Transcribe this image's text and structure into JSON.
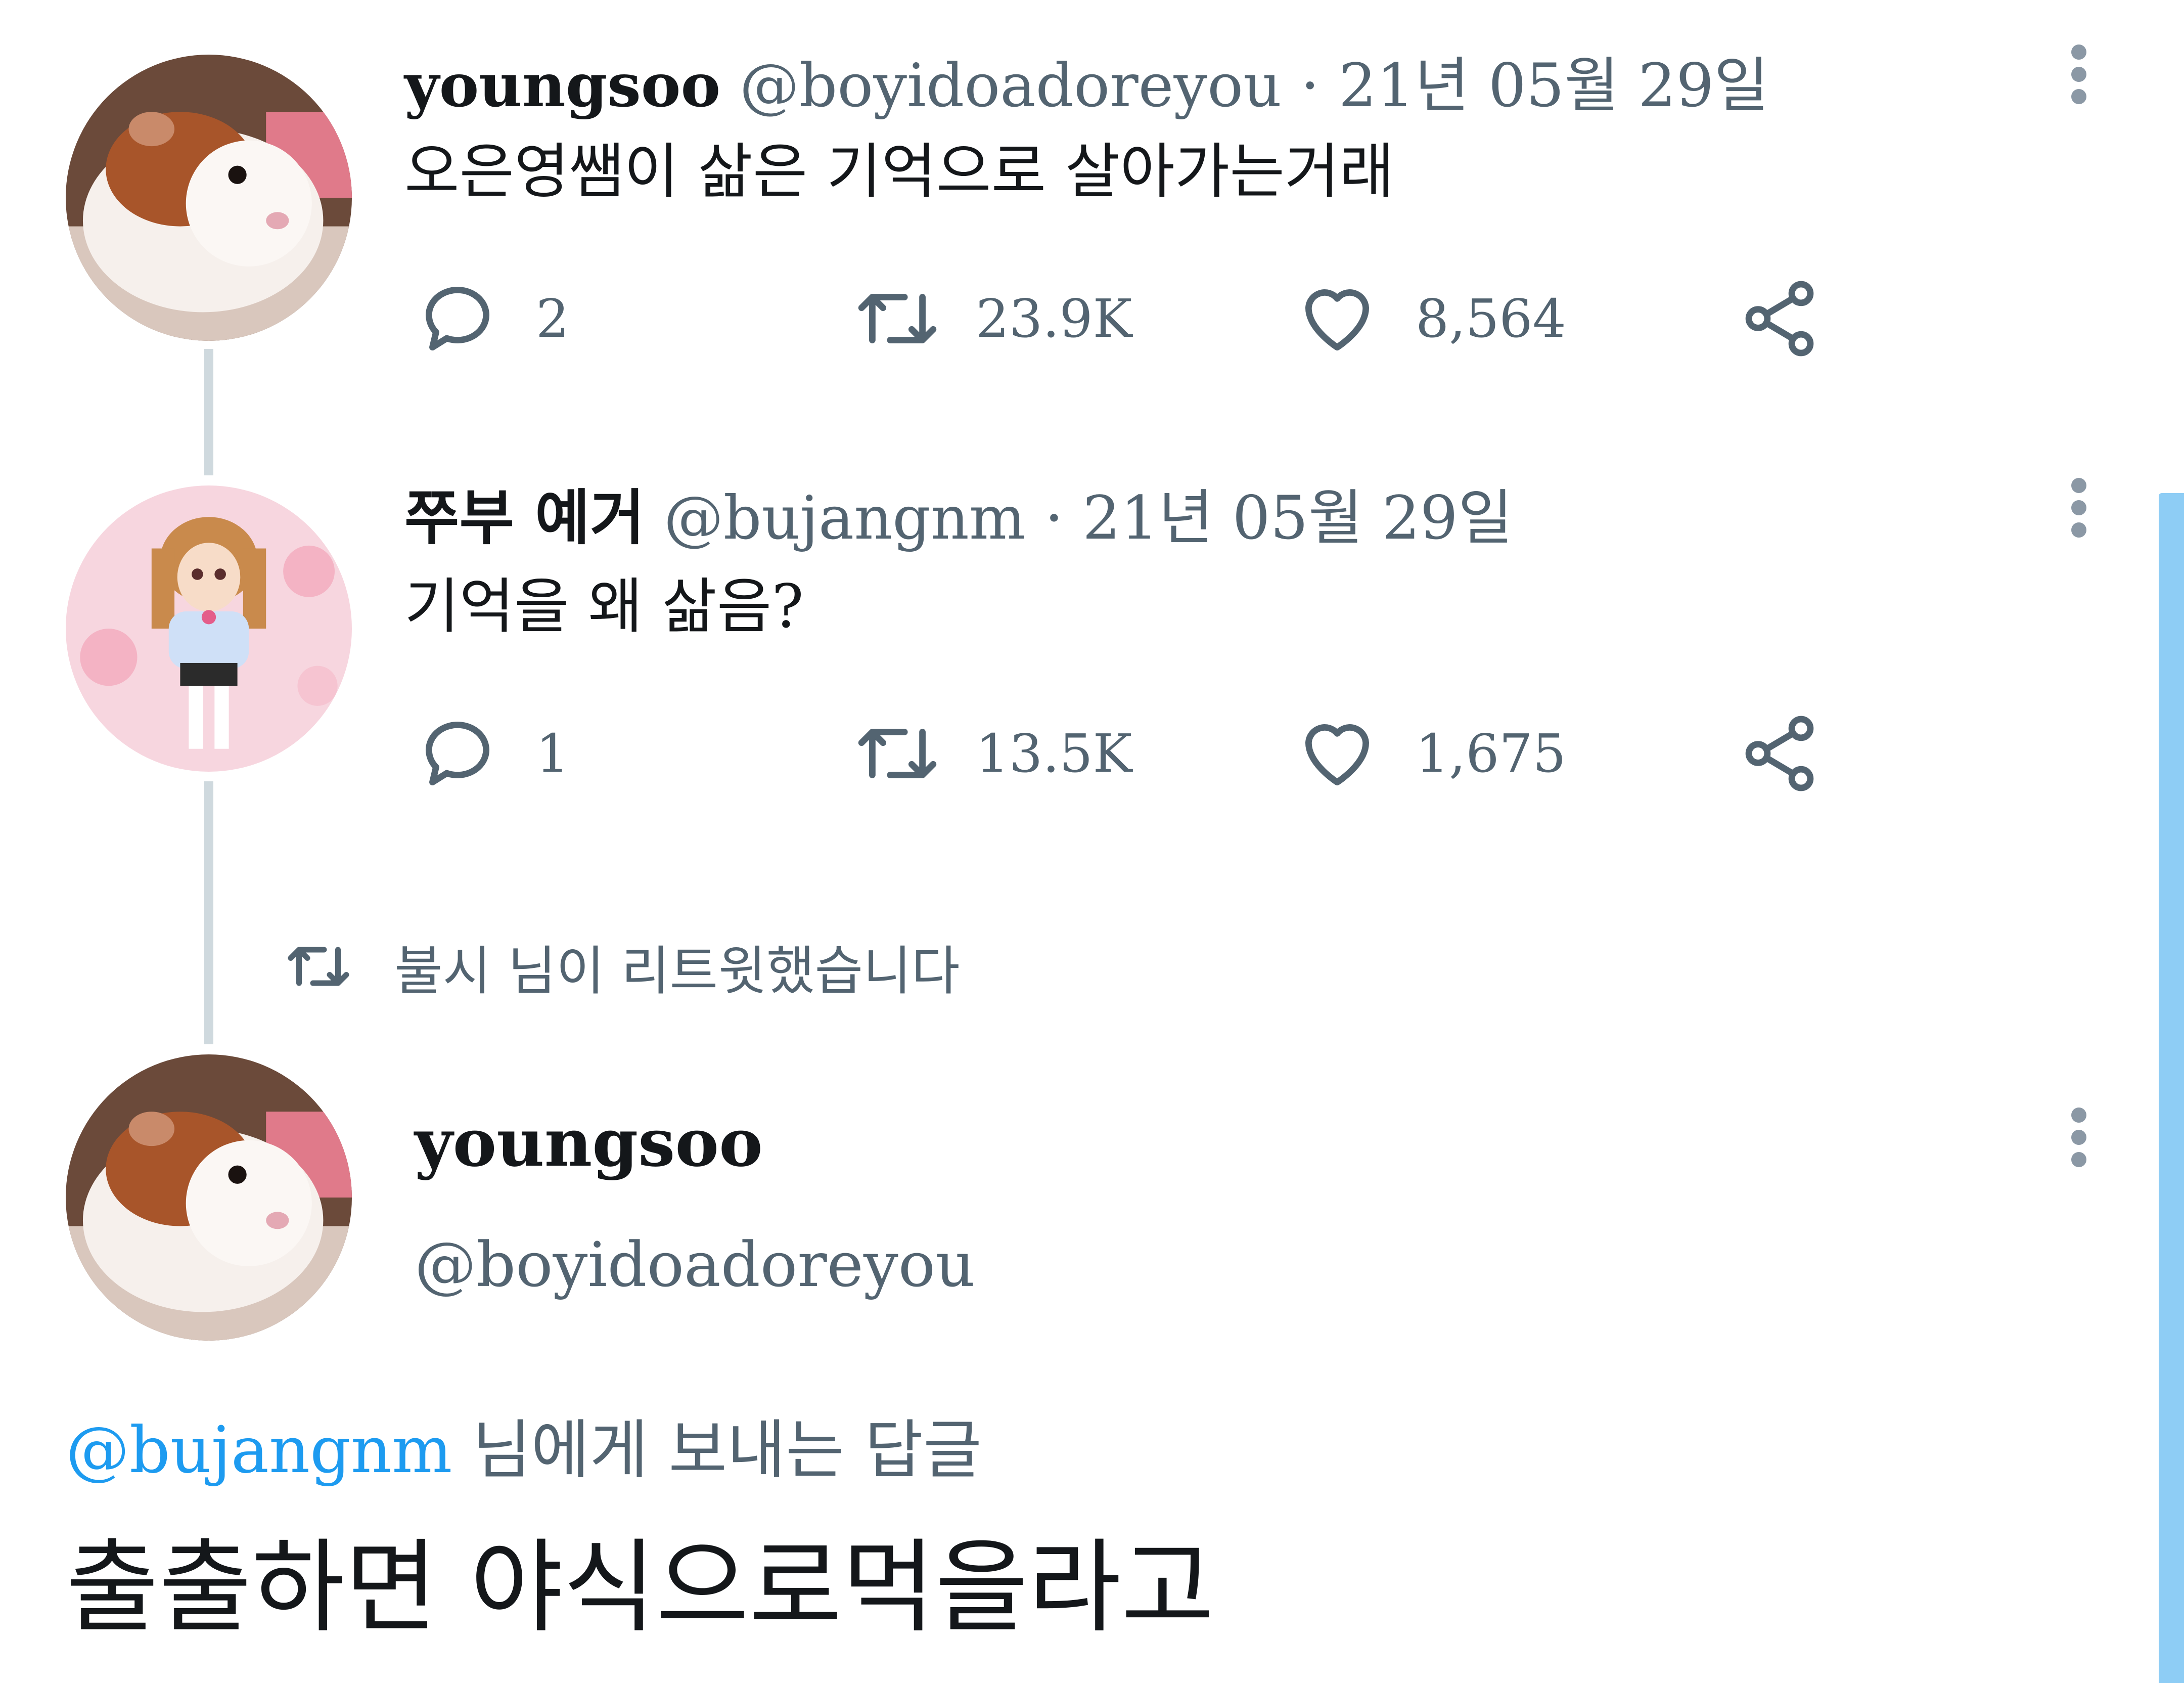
{
  "tweets": [
    {
      "name": "youngsoo",
      "handle": "@boyidoadoreyou",
      "date": " · 21년 05월 29일",
      "text": "오은영쌤이 삶은 기억으로 살아가는거래",
      "replies": "2",
      "retweets": "23.9K",
      "likes": "8,564",
      "avatar": "guinea-pig"
    },
    {
      "name": "쭈부 예거",
      "handle": "@bujangnm",
      "date": " · 21년 05월 29일",
      "text": "기억을 왜 삶음?",
      "replies": "1",
      "retweets": "13.5K",
      "likes": "1,675",
      "avatar": "anime-doll"
    }
  ],
  "retweet_notice": "불시 님이 리트윗했습니다",
  "main": {
    "name": "youngsoo",
    "handle": "@boyidoadoreyou",
    "reply_mention": "@bujangnm",
    "reply_suffix": " 님에게 보내는 답글",
    "text": "출출하면 야식으로먹을라고"
  },
  "colors": {
    "text": "#14171a",
    "secondary": "#536471",
    "accent": "#1d9bf0",
    "thread_line": "#cfd9de"
  },
  "icons": [
    "reply-icon",
    "retweet-icon",
    "like-icon",
    "share-icon",
    "more-icon"
  ]
}
